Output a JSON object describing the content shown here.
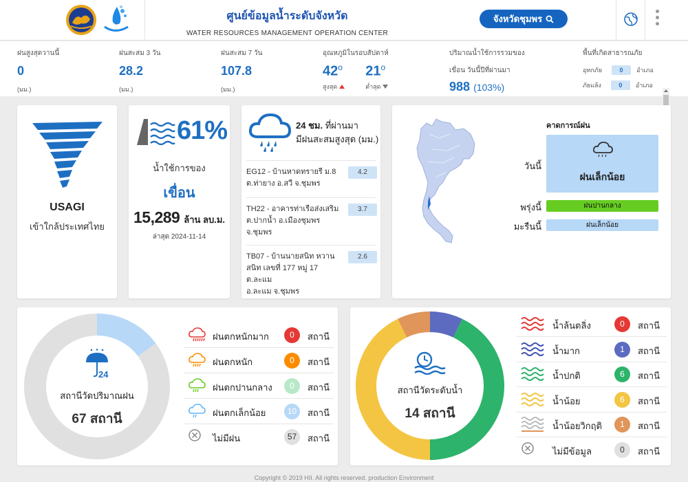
{
  "header": {
    "title_th": "ศูนย์ข้อมูลน้ำระดับจังหวัด",
    "title_en": "WATER RESOURCES MANAGEMENT OPERATION CENTER",
    "province_button": "จังหวัดชุมพร"
  },
  "stats": {
    "max_rain_today": {
      "label": "ฝนสูงสุดวานนี้",
      "value": "0",
      "unit": "(มม.)"
    },
    "rain_3day": {
      "label": "ฝนสะสม 3 วัน",
      "value": "28.2",
      "unit": "(มม.)"
    },
    "rain_7day": {
      "label": "ฝนสะสม 7 วัน",
      "value": "107.8",
      "unit": "(มม.)"
    },
    "temperature": {
      "label": "อุณหภูมิในรอบสัปดาห์",
      "high": "42",
      "high_label": "สูงสุด",
      "low": "21",
      "low_label": "ต่ำสุด"
    },
    "dam_volume": {
      "label_1": "ปริมาณน้ำใช้การรวมของ",
      "label_2": "เขื่อน วันนี้ปีที่ผ่านมา",
      "value": "988",
      "percent": "(103%)"
    },
    "disaster": {
      "label": "พื้นที่เกิดสาธารณภัย",
      "flood_label": "อุทกภัย",
      "flood_value": "0",
      "drought_label": "ภัยแล้ง",
      "drought_value": "0",
      "unit": "อำเภอ"
    }
  },
  "storm": {
    "name": "USAGI",
    "description": "เข้าใกล้ประเทศไทย"
  },
  "dam": {
    "percent": "61%",
    "line1": "น้ำใช้การของ",
    "line2": "เขื่อน",
    "volume": "15,289",
    "volume_unit": "ล้าน ลบ.ม.",
    "updated": "ล่าสุด 2024-11-14"
  },
  "rain24": {
    "title_1": "24 ชม.",
    "title_1b": "ที่ผ่านมา",
    "title_2": "มีฝนสะสมสูงสุด (มม.)",
    "stations": [
      {
        "text_1": "EG12 - บ้านหาดทรายรี ม.8",
        "text_2": "ต.ท่ายาง อ.สวี จ.ชุมพร",
        "text_3": "",
        "value": "4.2"
      },
      {
        "text_1": "TH22 - อาคารท่าเรือส่งเสริม",
        "text_2": "ต.ปากน้ำ อ.เมืองชุมพร",
        "text_3": "จ.ชุมพร",
        "value": "3.7"
      },
      {
        "text_1": "TB07 - บ้านนายสนิท หวาน",
        "text_2": "สนิท เลขที่ 177 หมู่ 17 ต.ละแม",
        "text_3": "อ.ละแม จ.ชุมพร",
        "value": "2.6"
      }
    ]
  },
  "forecast": {
    "title": "คาดการณ์ฝน",
    "today_label": "วันนี้",
    "today_value": "ฝนเล็กน้อย",
    "tomorrow_label": "พรุ่งนี้",
    "tomorrow_value": "ฝนปานกลาง",
    "day_after_label": "มะรืนนี้",
    "day_after_value": "ฝนเล็กน้อย",
    "colors": {
      "today": "#b7d8f7",
      "tomorrow": "#66cc22",
      "day_after": "#b7d8f7"
    }
  },
  "rain_stations": {
    "label": "สถานีวัดปริมาณฝน",
    "total": "67 สถานี",
    "legend": [
      {
        "name": "ฝนตกหนักมาก",
        "count": "0",
        "unit": "สถานี",
        "color": "#e53935"
      },
      {
        "name": "ฝนตกหนัก",
        "count": "0",
        "unit": "สถานี",
        "color": "#fb8c00"
      },
      {
        "name": "ฝนตกปานกลาง",
        "count": "0",
        "unit": "สถานี",
        "color": "#b9e8c8"
      },
      {
        "name": "ฝนตกเล็กน้อย",
        "count": "10",
        "unit": "สถานี",
        "color": "#b7d8f7"
      },
      {
        "name": "ไม่มีฝน",
        "count": "57",
        "unit": "สถานี",
        "color": "#e0e0e0"
      }
    ]
  },
  "water_stations": {
    "label": "สถานีวัดระดับน้ำ",
    "total": "14 สถานี",
    "legend": [
      {
        "name": "น้ำล้นตลิ่ง",
        "count": "0",
        "unit": "สถานี",
        "color": "#e53935"
      },
      {
        "name": "น้ำมาก",
        "count": "1",
        "unit": "สถานี",
        "color": "#5c6bc0"
      },
      {
        "name": "น้ำปกติ",
        "count": "6",
        "unit": "สถานี",
        "color": "#2db36b"
      },
      {
        "name": "น้ำน้อย",
        "count": "6",
        "unit": "สถานี",
        "color": "#f4c542"
      },
      {
        "name": "น้ำน้อยวิกฤติ",
        "count": "1",
        "unit": "สถานี",
        "color": "#e0955a"
      },
      {
        "name": "ไม่มีข้อมูล",
        "count": "0",
        "unit": "สถานี",
        "color": "#e0e0e0"
      }
    ]
  },
  "footer": {
    "text": "Copyright © 2019 HII. All rights reserved. production Environment"
  }
}
